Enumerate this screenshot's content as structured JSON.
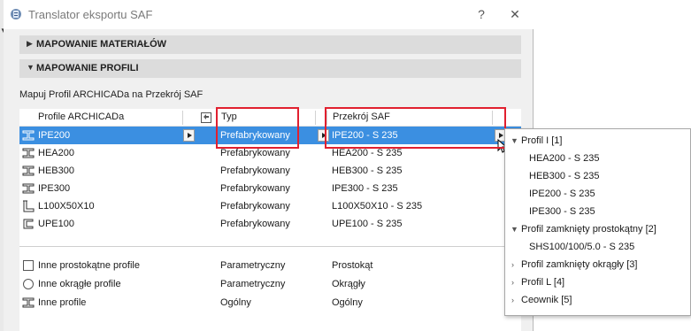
{
  "window": {
    "title": "Translator eksportu SAF",
    "help": "?",
    "close": "✕"
  },
  "sections": [
    {
      "arrow": "▶",
      "label": "MAPOWANIE MATERIAŁÓW"
    },
    {
      "arrow": "▼",
      "label": "MAPOWANIE PROFILI"
    }
  ],
  "map_label": "Mapuj Profil ARCHICADa na Przekrój SAF",
  "table": {
    "headers": [
      "Profile ARCHICADa",
      "Typ",
      "Przekrój SAF"
    ],
    "rows": [
      {
        "name": "IPE200",
        "type": "Prefabrykowany",
        "saf": "IPE200 - S 235"
      },
      {
        "name": "HEA200",
        "type": "Prefabrykowany",
        "saf": "HEA200 - S 235"
      },
      {
        "name": "HEB300",
        "type": "Prefabrykowany",
        "saf": "HEB300 - S 235"
      },
      {
        "name": "IPE300",
        "type": "Prefabrykowany",
        "saf": "IPE300 - S 235"
      },
      {
        "name": "L100X50X10",
        "type": "Prefabrykowany",
        "saf": "L100X50X10 - S 235"
      },
      {
        "name": "UPE100",
        "type": "Prefabrykowany",
        "saf": "UPE100 - S 235"
      }
    ],
    "other_rows": [
      {
        "icon": "rect-profile-icon",
        "name": "Inne prostokątne profile",
        "type": "Parametryczny",
        "saf": "Prostokąt"
      },
      {
        "icon": "circle-profile-icon",
        "name": "Inne okrągłe profile",
        "type": "Parametryczny",
        "saf": "Okrągły"
      },
      {
        "icon": "i-beam-icon",
        "name": "Inne profile",
        "type": "Ogólny",
        "saf": "Ogólny"
      }
    ]
  },
  "popup": {
    "groups": [
      {
        "label": "Profil I [1]",
        "expanded": true,
        "items": [
          "HEA200 - S 235",
          "HEB300 - S 235",
          "IPE200 - S 235",
          "IPE300 - S 235"
        ]
      },
      {
        "label": "Profil zamknięty prostokątny [2]",
        "expanded": true,
        "items": [
          "SHS100/100/5.0 - S 235"
        ]
      },
      {
        "label": "Profil zamknięty okrągły [3]",
        "expanded": false,
        "items": []
      },
      {
        "label": "Profil L [4]",
        "expanded": false,
        "items": []
      },
      {
        "label": "Ceownik [5]",
        "expanded": false,
        "items": []
      }
    ]
  },
  "colors": {
    "selection": "#3b8fe1",
    "highlight": "#e1202f",
    "section_bg": "#dcdcdc"
  }
}
